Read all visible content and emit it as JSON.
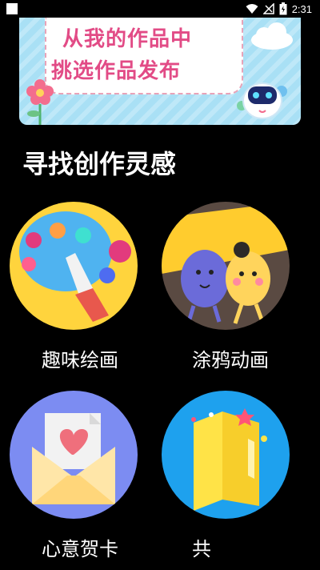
{
  "status_bar": {
    "time": "2:31"
  },
  "banner": {
    "line1": "从我的作品中",
    "line2": "挑选作品发布"
  },
  "section": {
    "title": "寻找创作灵感"
  },
  "categories": [
    {
      "label": "趣味绘画"
    },
    {
      "label": "涂鸦动画"
    },
    {
      "label": "心意贺卡"
    },
    {
      "label": "共"
    }
  ],
  "colors": {
    "background": "#000000",
    "banner_text": "#e24b86",
    "banner_bg": "#a9e0f5"
  }
}
